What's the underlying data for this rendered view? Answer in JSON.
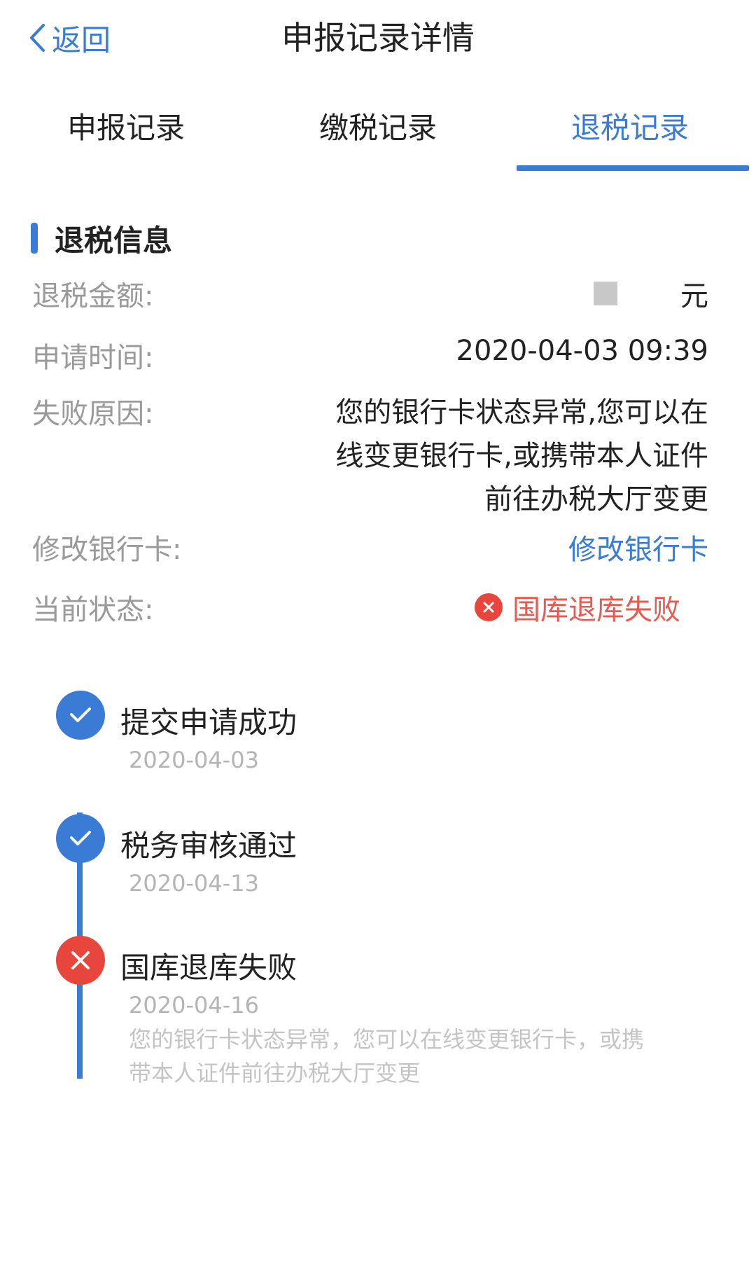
{
  "navbar": {
    "back_label": "返回",
    "title": "申报记录详情"
  },
  "tabs": [
    {
      "label": "申报记录",
      "active": false
    },
    {
      "label": "缴税记录",
      "active": false
    },
    {
      "label": "退税记录",
      "active": true
    }
  ],
  "section": {
    "title": "退税信息"
  },
  "info": {
    "amount_label": "退税金额:",
    "amount_unit": "元",
    "time_label": "申请时间:",
    "time_value": "2020-04-03 09:39",
    "reason_label": "失败原因:",
    "reason_value": "您的银行卡状态异常,您可以在线变更银行卡,或携带本人证件前往办税大厅变更",
    "bank_label": "修改银行卡:",
    "bank_link": "修改银行卡",
    "status_label": "当前状态:",
    "status_value": "国库退库失败"
  },
  "timeline": [
    {
      "title": "提交申请成功",
      "date": "2020-04-03",
      "status": "done"
    },
    {
      "title": "税务审核通过",
      "date": "2020-04-13",
      "status": "done"
    },
    {
      "title": "国库退库失败",
      "date": "2020-04-16",
      "status": "failed",
      "description": "您的银行卡状态异常，您可以在线变更银行卡，或携带本人证件前往办税大厅变更"
    }
  ],
  "colors": {
    "accent": "#3a7bd5",
    "error": "#e8453c",
    "label_gray": "#9a9a9a"
  },
  "icons": {
    "back": "chevron-left-icon",
    "done": "check-icon",
    "failed": "close-icon"
  }
}
